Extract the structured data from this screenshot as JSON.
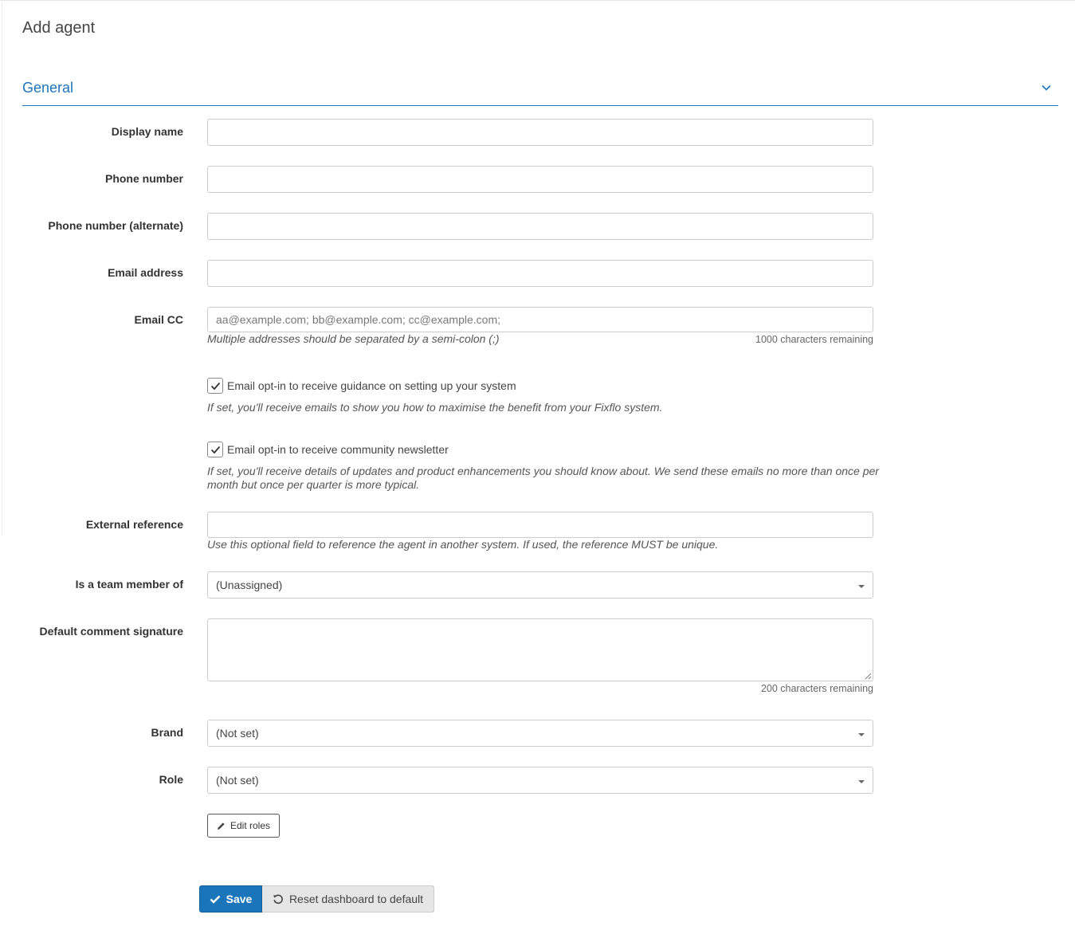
{
  "page": {
    "title": "Add agent"
  },
  "section": {
    "title": "General",
    "toggle_icon": "chevron-down-icon"
  },
  "fields": {
    "display_name": {
      "label": "Display name",
      "value": "",
      "placeholder": ""
    },
    "phone_number": {
      "label": "Phone number",
      "value": "",
      "placeholder": ""
    },
    "phone_alternate": {
      "label": "Phone number (alternate)",
      "value": "",
      "placeholder": ""
    },
    "email_address": {
      "label": "Email address",
      "value": "",
      "placeholder": ""
    },
    "email_cc": {
      "label": "Email CC",
      "value": "",
      "placeholder": "aa@example.com; bb@example.com; cc@example.com;",
      "help": "Multiple addresses should be separated by a semi-colon (;)",
      "counter": "1000 characters remaining"
    },
    "optin_guidance": {
      "label": "Email opt-in to receive guidance on setting up your system",
      "checked": true,
      "help": "If set, you'll receive emails to show you how to maximise the benefit from your Fixflo system."
    },
    "optin_newsletter": {
      "label": "Email opt-in to receive community newsletter",
      "checked": true,
      "help_line1": "If set, you'll receive details of updates and product enhancements you should know about. We send these emails no more than once per",
      "help_line2": "month but once per quarter is more typical."
    },
    "external_reference": {
      "label": "External reference",
      "value": "",
      "help": "Use this optional field to reference the agent in another system. If used, the reference MUST be unique."
    },
    "team": {
      "label": "Is a team member of",
      "selected": "(Unassigned)"
    },
    "signature": {
      "label": "Default comment signature",
      "value": "",
      "counter": "200 characters remaining"
    },
    "brand": {
      "label": "Brand",
      "selected": "(Not set)"
    },
    "role": {
      "label": "Role",
      "selected": "(Not set)"
    }
  },
  "buttons": {
    "edit_roles": "Edit roles",
    "save": "Save",
    "reset": "Reset dashboard to default"
  },
  "colors": {
    "accent": "#1b75bb",
    "reset_bg": "#e6e6e6"
  }
}
